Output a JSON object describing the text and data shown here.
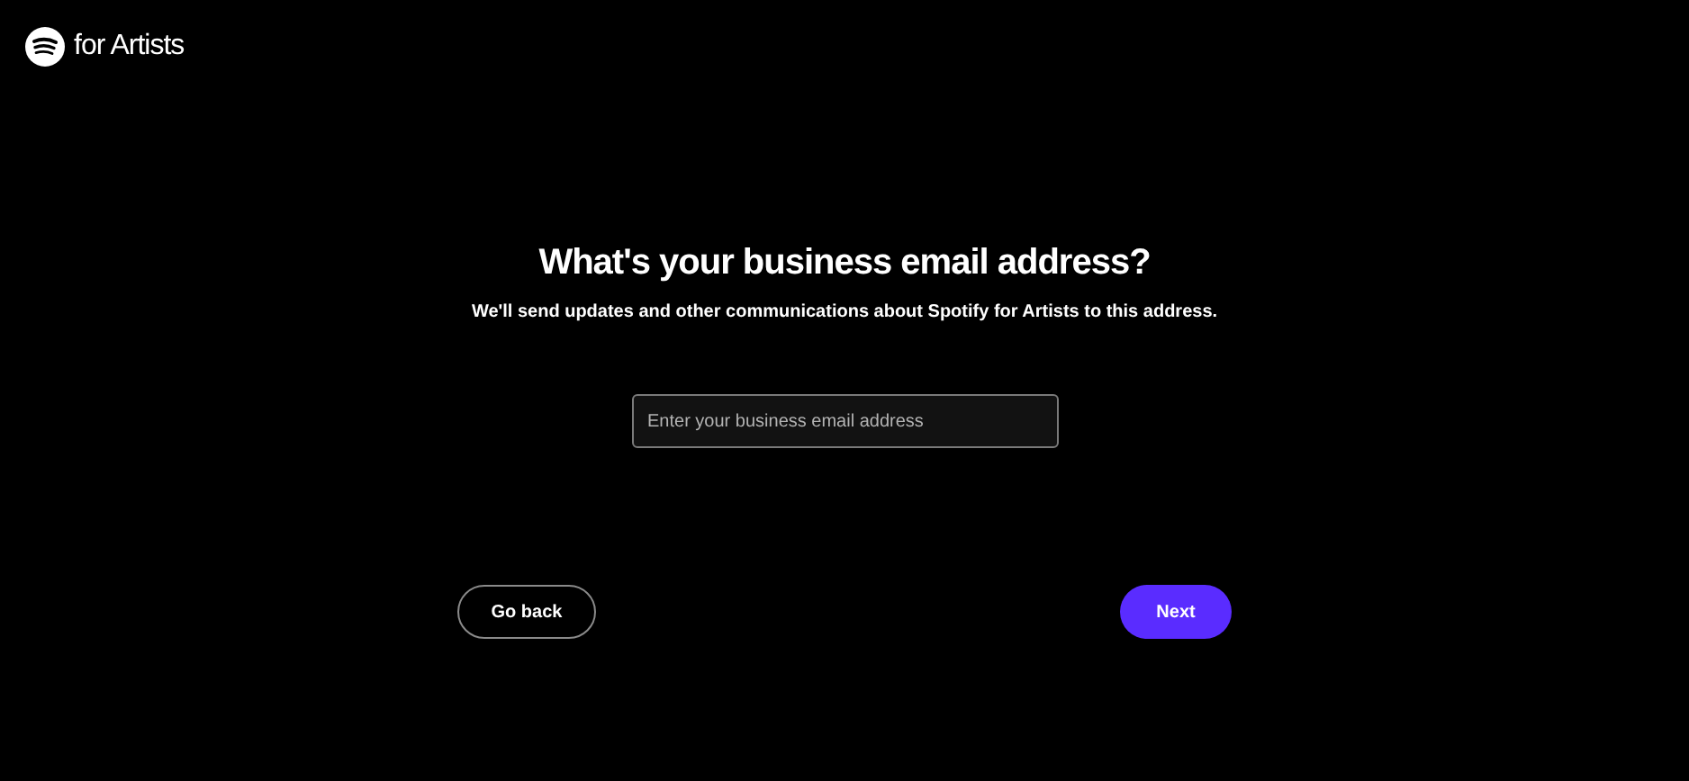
{
  "header": {
    "logo_text": "for Artists"
  },
  "title": "What's your business email address?",
  "subtitle": "We'll send updates and other communications about Spotify for Artists to this address.",
  "email_field": {
    "placeholder": "Enter your business email address"
  },
  "buttons": [
    {
      "label": "Go back",
      "kind": "secondary"
    },
    {
      "label": "Next",
      "kind": "primary"
    }
  ]
}
